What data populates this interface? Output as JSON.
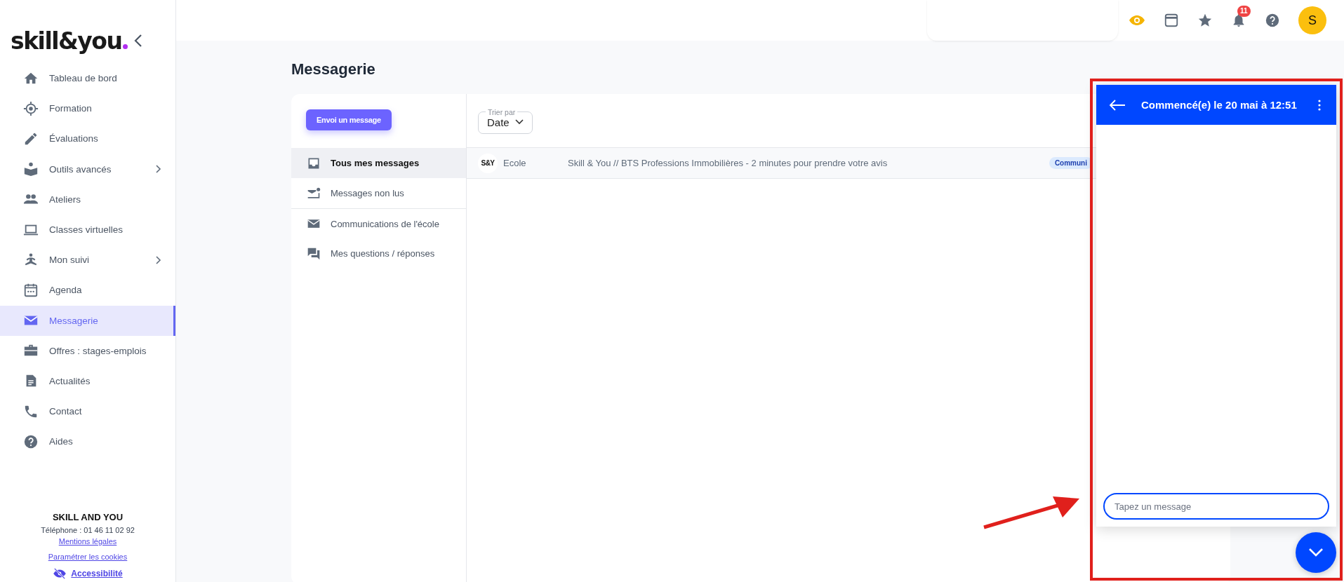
{
  "logo": {
    "text": "skill&you"
  },
  "sidebar": {
    "items": [
      {
        "label": "Tableau de bord",
        "selected": false,
        "has_submenu": false
      },
      {
        "label": "Formation",
        "selected": false,
        "has_submenu": false
      },
      {
        "label": "Évaluations",
        "selected": false,
        "has_submenu": false
      },
      {
        "label": "Outils avancés",
        "selected": false,
        "has_submenu": true
      },
      {
        "label": "Ateliers",
        "selected": false,
        "has_submenu": false
      },
      {
        "label": "Classes virtuelles",
        "selected": false,
        "has_submenu": false
      },
      {
        "label": "Mon suivi",
        "selected": false,
        "has_submenu": true
      },
      {
        "label": "Agenda",
        "selected": false,
        "has_submenu": false
      },
      {
        "label": "Messagerie",
        "selected": true,
        "has_submenu": false
      },
      {
        "label": "Offres : stages-emplois",
        "selected": false,
        "has_submenu": false
      },
      {
        "label": "Actualités",
        "selected": false,
        "has_submenu": false
      },
      {
        "label": "Contact",
        "selected": false,
        "has_submenu": false
      },
      {
        "label": "Aides",
        "selected": false,
        "has_submenu": false
      }
    ],
    "footer": {
      "company": "SKILL AND YOU",
      "phone": "Téléphone : 01 46 11 02 92",
      "links": [
        "Mentions légales",
        "Paramétrer les cookies"
      ],
      "accessibility": "Accessibilité"
    }
  },
  "topbar": {
    "notifications": "11",
    "avatar": "S"
  },
  "page_title": "Messagerie",
  "compose_button": "Envoi un message",
  "folders": [
    {
      "label": "Tous mes messages",
      "selected": true
    },
    {
      "label": "Messages non lus",
      "selected": false
    },
    {
      "label": "Communications de l'école",
      "selected": false
    },
    {
      "label": "Mes questions / réponses",
      "selected": false
    }
  ],
  "sort": {
    "label": "Trier par",
    "value": "Date"
  },
  "messages": [
    {
      "logo": "S&Y",
      "sender": "Ecole",
      "subject": "Skill & You // BTS Professions Immobilières - 2 minutes pour prendre votre avis",
      "tag": "Communi"
    }
  ],
  "chat": {
    "title": "Commencé(e) le 20 mai à 12:51",
    "input": {
      "placeholder": "Tapez un message"
    }
  }
}
